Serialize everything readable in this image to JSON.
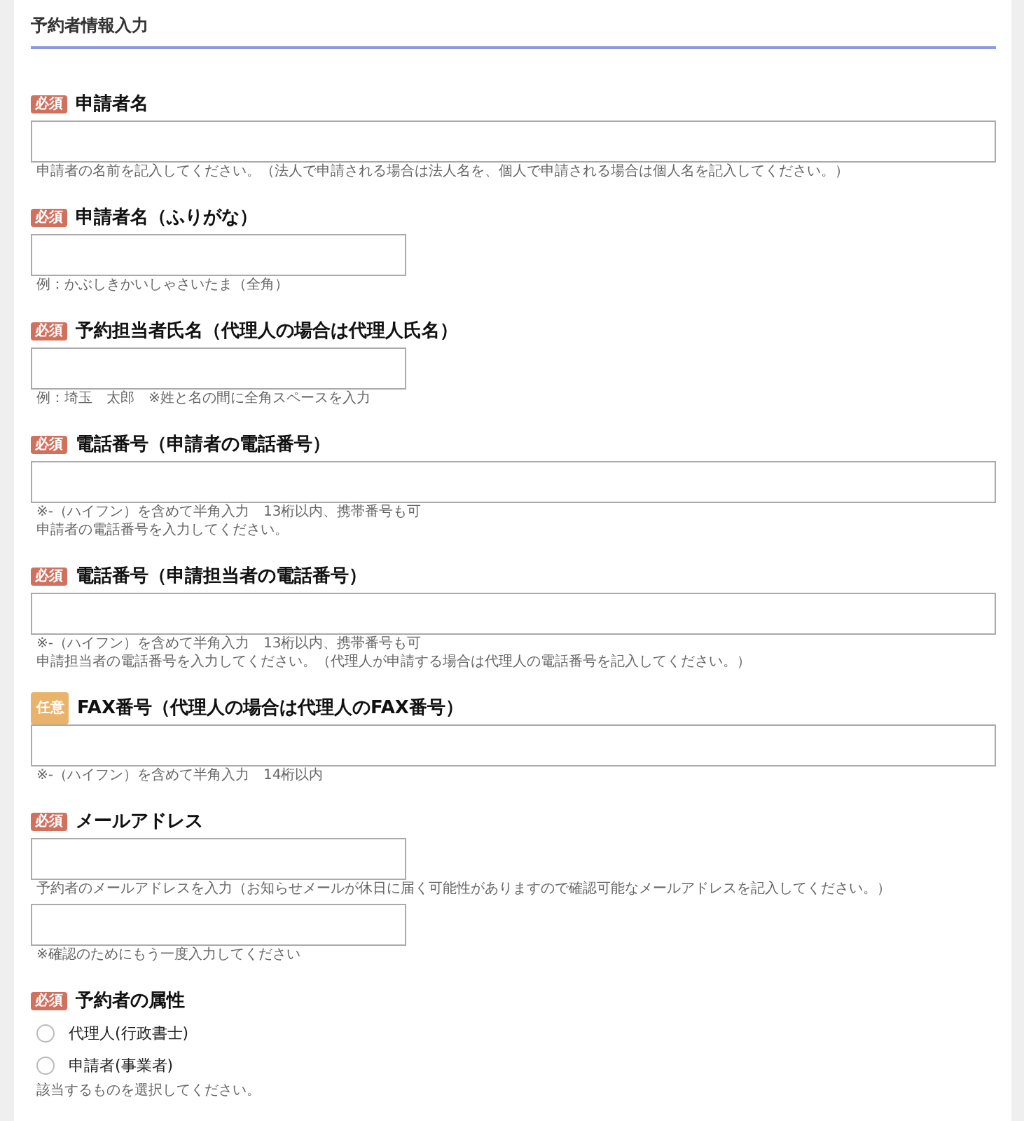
{
  "section": {
    "title": "予約者情報入力"
  },
  "fields": [
    {
      "kind": "text",
      "badge": {
        "label": "必須",
        "kind": "required"
      },
      "label": "申請者名",
      "inputs": [
        {
          "kind": "wide",
          "hints": [
            "申請者の名前を記入してください。（法人で申請される場合は法人名を、個人で申請される場合は個人名を記入してください。）"
          ]
        }
      ]
    },
    {
      "kind": "text",
      "badge": {
        "label": "必須",
        "kind": "required"
      },
      "label": "申請者名（ふりがな）",
      "inputs": [
        {
          "kind": "narrow",
          "hints": [
            "例：かぶしきかいしゃさいたま（全角）"
          ]
        }
      ]
    },
    {
      "kind": "text",
      "badge": {
        "label": "必須",
        "kind": "required"
      },
      "label": "予約担当者氏名（代理人の場合は代理人氏名）",
      "inputs": [
        {
          "kind": "narrow",
          "hints": [
            "例：埼玉　太郎　※姓と名の間に全角スペースを入力"
          ]
        }
      ]
    },
    {
      "kind": "text",
      "badge": {
        "label": "必須",
        "kind": "required"
      },
      "label": "電話番号（申請者の電話番号）",
      "inputs": [
        {
          "kind": "wide",
          "hints": [
            "※-（ハイフン）を含めて半角入力　13桁以内、携帯番号も可",
            "申請者の電話番号を入力してください。"
          ]
        }
      ]
    },
    {
      "kind": "text",
      "badge": {
        "label": "必須",
        "kind": "required"
      },
      "label": "電話番号（申請担当者の電話番号）",
      "inputs": [
        {
          "kind": "wide",
          "hints": [
            "※-（ハイフン）を含めて半角入力　13桁以内、携帯番号も可",
            "申請担当者の電話番号を入力してください。（代理人が申請する場合は代理人の電話番号を記入してください。）"
          ]
        }
      ]
    },
    {
      "kind": "text",
      "badge": {
        "label": "任意",
        "kind": "optional"
      },
      "label": "FAX番号（代理人の場合は代理人のFAX番号）",
      "inputs": [
        {
          "kind": "wide",
          "hints": [
            "※-（ハイフン）を含めて半角入力　14桁以内"
          ]
        }
      ]
    },
    {
      "kind": "text",
      "badge": {
        "label": "必須",
        "kind": "required"
      },
      "label": "メールアドレス",
      "inputs": [
        {
          "kind": "narrow",
          "hints": [
            "予約者のメールアドレスを入力（お知らせメールが休日に届く可能性がありますので確認可能なメールアドレスを記入してください。）"
          ]
        },
        {
          "kind": "narrow",
          "hints": [
            "※確認のためにもう一度入力してください"
          ]
        }
      ]
    },
    {
      "kind": "radio",
      "badge": {
        "label": "必須",
        "kind": "required"
      },
      "label": "予約者の属性",
      "options": [
        {
          "label": "代理人(行政書士)",
          "selected": false
        },
        {
          "label": "申請者(事業者)",
          "selected": false
        }
      ],
      "hints": [
        "該当するものを選択してください。"
      ]
    }
  ]
}
